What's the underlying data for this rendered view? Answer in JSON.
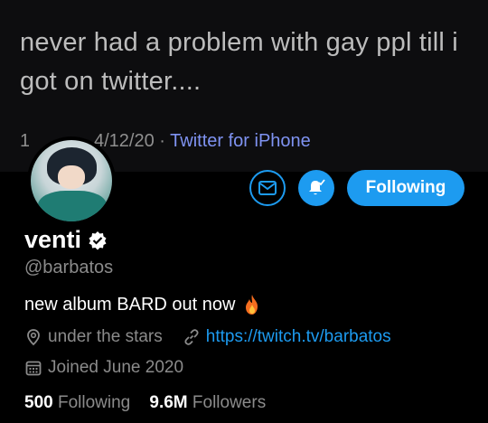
{
  "tweet": {
    "text_line1": "never had a problem with gay ppl till i",
    "text_line2": "got on twitter....",
    "time_clipped": "1:",
    "date": "4/12/20",
    "separator": "·",
    "source": "Twitter for iPhone"
  },
  "actions": {
    "message_icon": "envelope-icon",
    "bell_icon": "bell-check-icon",
    "follow_label": "Following"
  },
  "profile": {
    "name": "venti",
    "handle": "@barbatos",
    "bio": "new album BARD out now",
    "location": "under the stars",
    "url": "https://twitch.tv/barbatos",
    "joined": "Joined June 2020",
    "following_count": "500",
    "following_label": "Following",
    "followers_count": "9.6M",
    "followers_label": "Followers"
  },
  "colors": {
    "accent": "#1d9bf0",
    "background": "#000000",
    "secondary_text": "#8b8b8b"
  }
}
